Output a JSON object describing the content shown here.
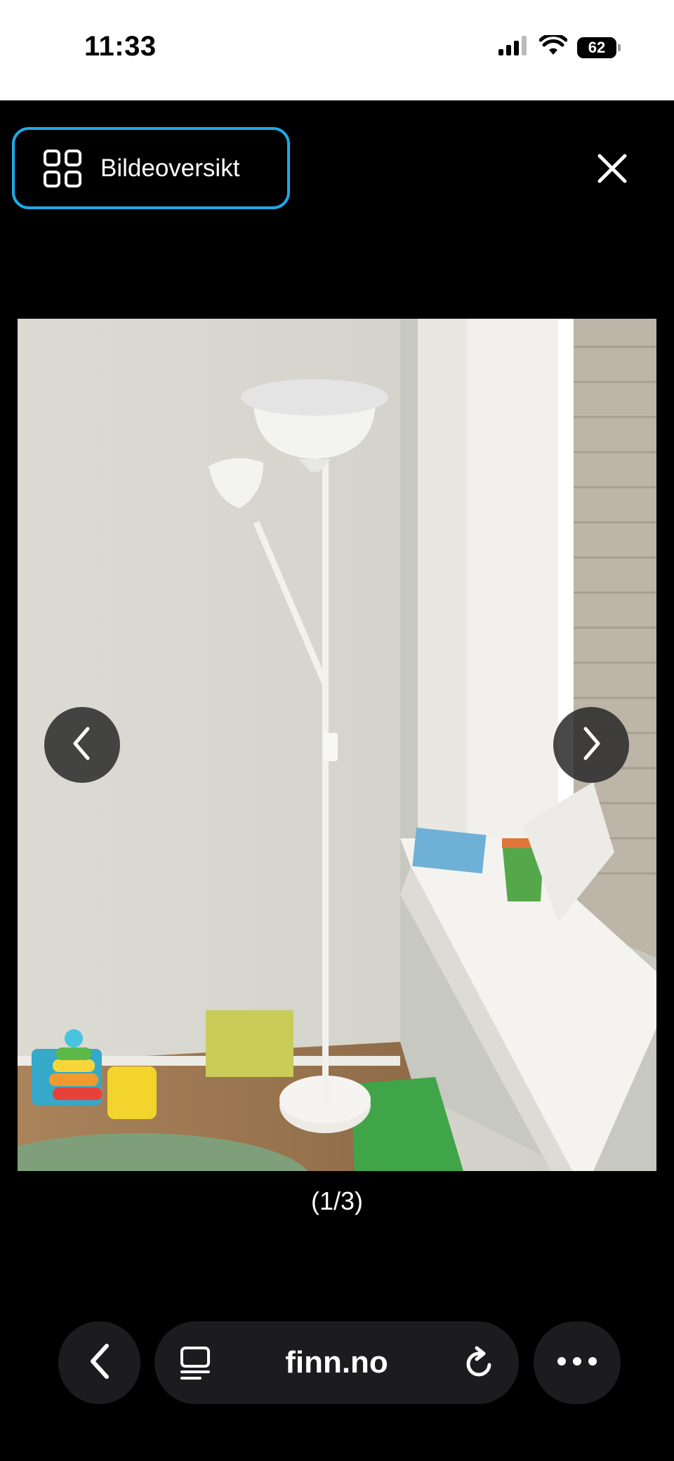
{
  "status_bar": {
    "time": "11:33",
    "battery_level": "62",
    "icons": [
      "cellular-signal-icon",
      "wifi-icon",
      "battery-icon"
    ]
  },
  "viewer": {
    "gallery_button_label": "Bildeoversikt",
    "gallery_icon": "grid-icon",
    "close_icon": "close-icon",
    "prev_icon": "chevron-left-icon",
    "next_icon": "chevron-right-icon",
    "counter": "(1/3)"
  },
  "browser": {
    "url": "finn.no",
    "back_icon": "chevron-left-icon",
    "reader_icon": "reader-mode-icon",
    "reload_icon": "reload-icon",
    "more_icon": "more-icon"
  },
  "colors": {
    "accent": "#1fa9e6",
    "background": "#000000",
    "pill": "#1c1c1e"
  }
}
